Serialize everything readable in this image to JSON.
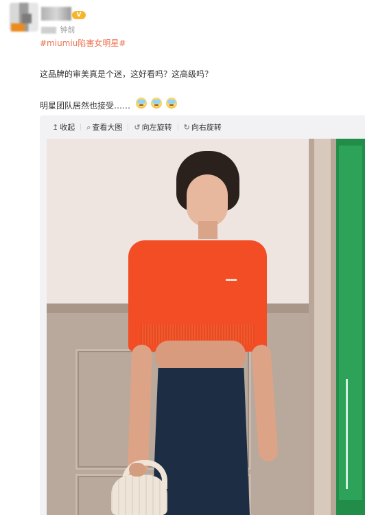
{
  "post": {
    "badge": "V",
    "meta_time": "钟前",
    "topic": "#miumiu陷害女明星#",
    "line1": "这品牌的审美真是个迷，这好看吗？这高级吗？",
    "line2": "明星团队居然也接受……"
  },
  "toolbar": {
    "collapse": "收起",
    "view_large": "查看大图",
    "rotate_left": "向左旋转",
    "rotate_right": "向右旋转"
  },
  "colors": {
    "topic_orange": "#eb7350",
    "sweater_orange": "#f24d24",
    "door_green": "#218d49",
    "skirt_navy": "#1d2e44"
  }
}
